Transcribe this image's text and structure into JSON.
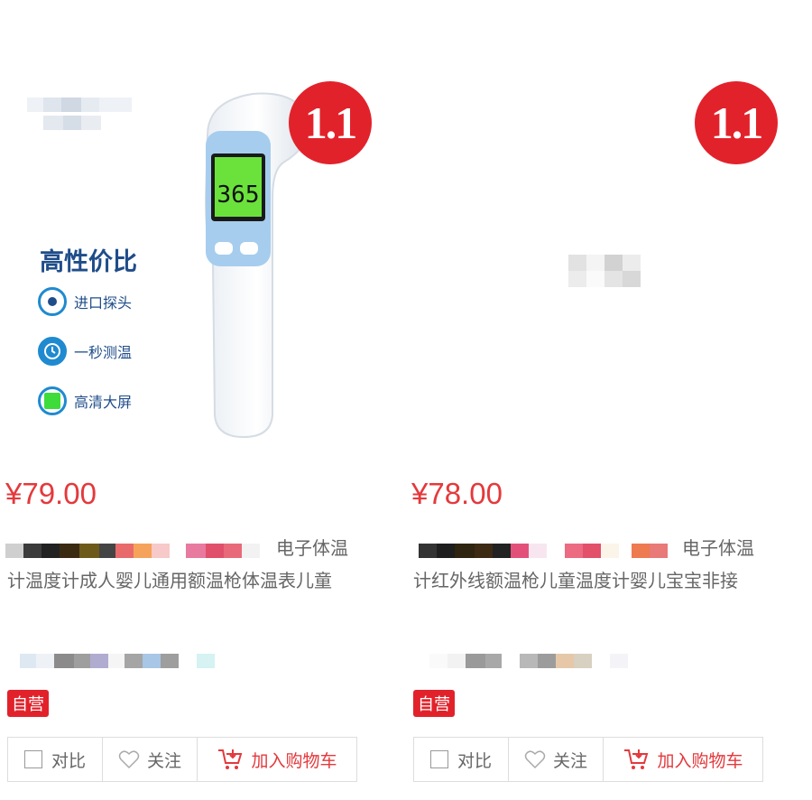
{
  "products": [
    {
      "badge": "1.1",
      "price": "¥79.00",
      "title_tail": "电子体温",
      "title_line2": "计温度计成人婴儿通用额温枪体温表儿童",
      "feature_heading": "高性价比",
      "features": [
        "进口探头",
        "一秒测温",
        "高清大屏"
      ],
      "display_reading": "365",
      "self_tag": "自营",
      "actions": {
        "compare": "对比",
        "follow": "关注",
        "cart": "加入购物车"
      }
    },
    {
      "badge": "1.1",
      "price": "¥78.00",
      "title_tail": "电子体温",
      "title_line2": "计红外线额温枪儿童温度计婴儿宝宝非接",
      "self_tag": "自营",
      "actions": {
        "compare": "对比",
        "follow": "关注",
        "cart": "加入购物车"
      }
    }
  ],
  "colors": {
    "accent": "#e4393c",
    "badge": "#e2222b",
    "feature": "#1f4d8a"
  }
}
